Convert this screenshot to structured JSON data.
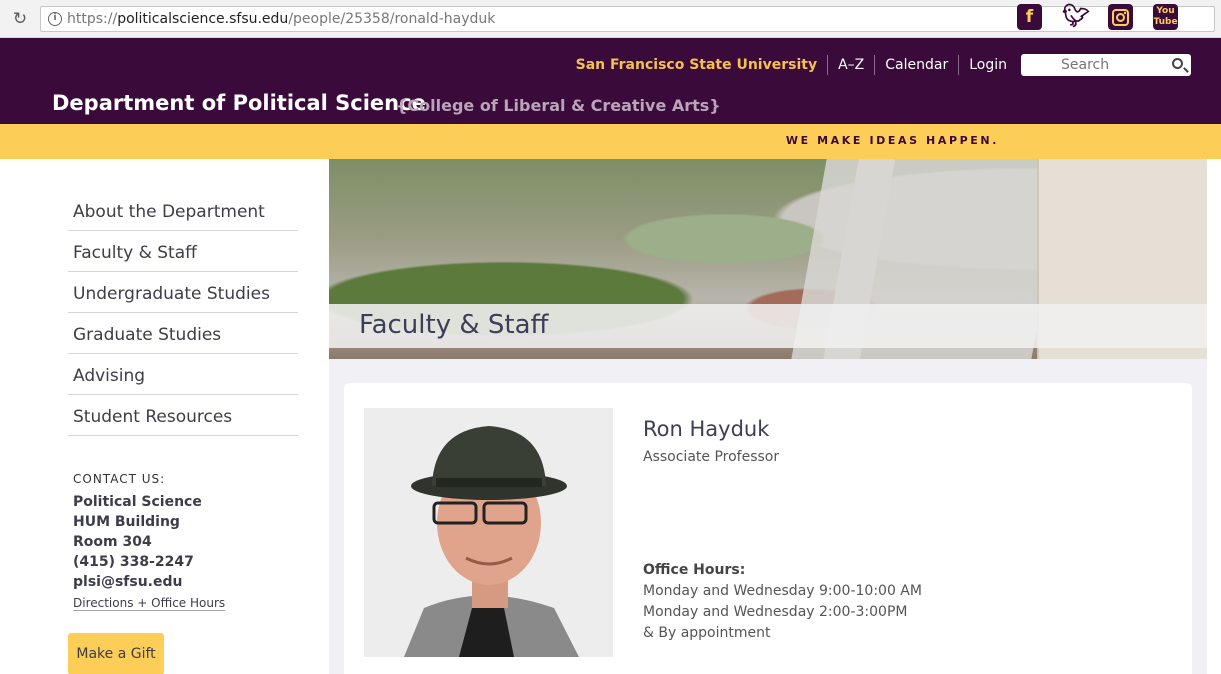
{
  "browser": {
    "url_scheme": "https://",
    "url_host": "politicalscience.sfsu.edu",
    "url_path": "/people/25358/ronald-hayduk"
  },
  "header": {
    "university": "San Francisco State University",
    "nav": [
      "A–Z",
      "Calendar",
      "Login"
    ],
    "search_placeholder": "Search",
    "department": "Department of Political Science",
    "college": "{College of Liberal & Creative Arts}",
    "colors": {
      "purple": "#3a0a3b",
      "gold": "#fcce58"
    }
  },
  "tagline": "WE MAKE IDEAS HAPPEN.",
  "social": [
    "facebook-icon",
    "twitter-icon",
    "instagram-icon",
    "youtube-icon"
  ],
  "sidebar": {
    "items": [
      {
        "label": "About the Department"
      },
      {
        "label": "Faculty & Staff"
      },
      {
        "label": "Undergraduate Studies"
      },
      {
        "label": "Graduate Studies"
      },
      {
        "label": "Advising"
      },
      {
        "label": "Student Resources"
      }
    ],
    "contact": {
      "heading": "CONTACT US:",
      "lines": [
        "Political Science",
        "HUM Building",
        "Room 304",
        "(415) 338-2247",
        "plsi@sfsu.edu"
      ],
      "directions": "Directions + Office Hours"
    },
    "gift_label": "Make a Gift"
  },
  "hero": {
    "title": "Faculty & Staff"
  },
  "profile": {
    "name": "Ron Hayduk",
    "title": "Associate Professor",
    "office_hours_label": "Office Hours:",
    "office_hours": [
      "Monday and Wednesday 9:00-10:00 AM",
      "Monday and Wednesday 2:00-3:00PM",
      "& By appointment"
    ]
  }
}
